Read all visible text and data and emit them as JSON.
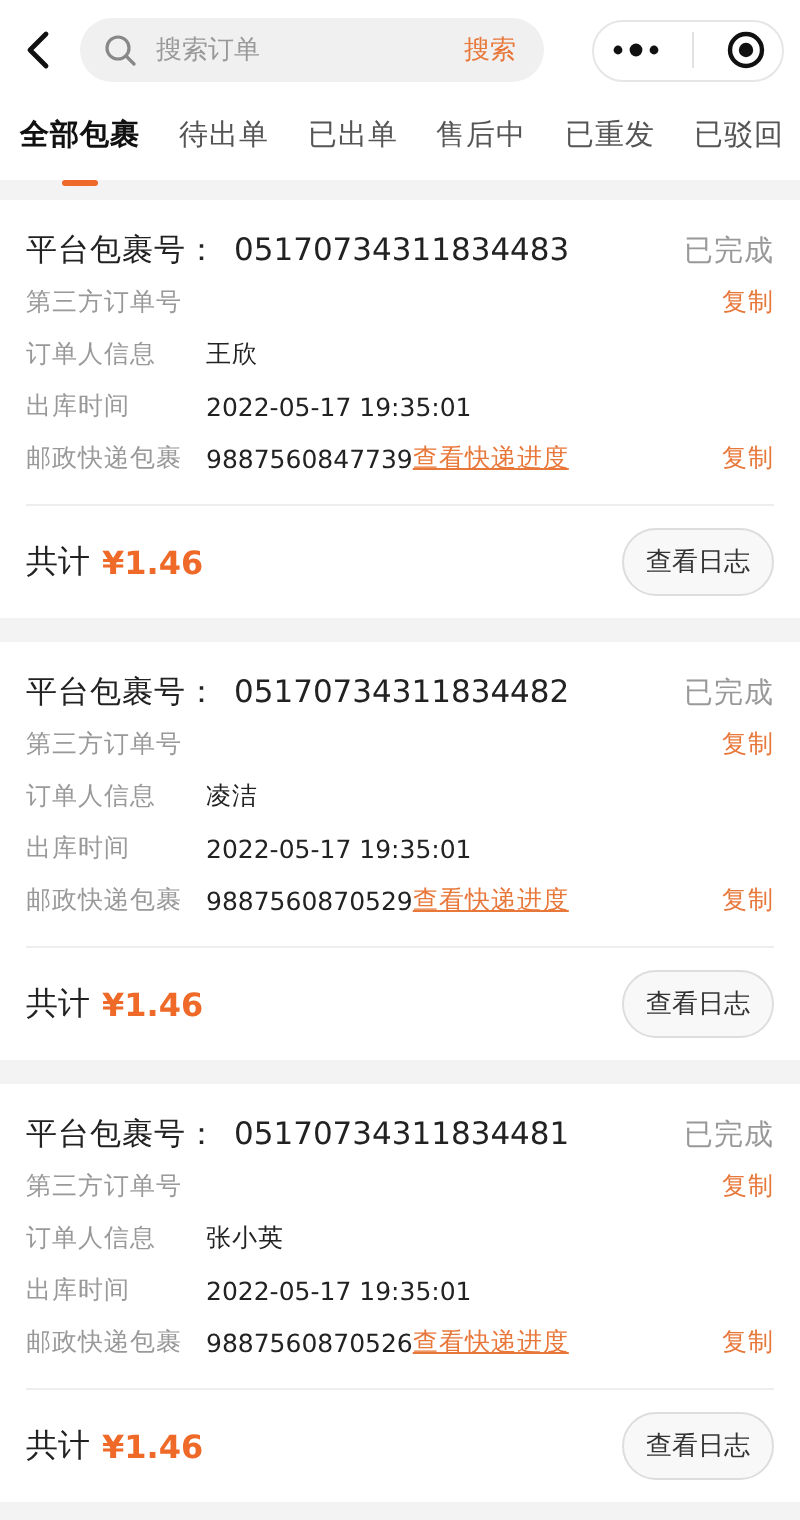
{
  "header": {
    "search": {
      "placeholder": "搜索订单",
      "button": "搜索"
    }
  },
  "tabs": [
    {
      "label": "全部包裹",
      "selected": true
    },
    {
      "label": "待出单",
      "selected": false
    },
    {
      "label": "已出单",
      "selected": false
    },
    {
      "label": "售后中",
      "selected": false
    },
    {
      "label": "已重发",
      "selected": false
    },
    {
      "label": "已驳回",
      "selected": false
    }
  ],
  "orders": [
    {
      "package_label": "平台包裹号：",
      "package_no": "05170734311834483",
      "status": "已完成",
      "fields": [
        {
          "label": "第三方订单号",
          "action": "复制"
        },
        {
          "label": "订单人信息",
          "value": "王欣"
        },
        {
          "label": "出库时间",
          "value": "2022-05-17 19:35:01"
        },
        {
          "label": "邮政快递包裹",
          "value": "9887560847739",
          "link": "查看快递进度",
          "action": "复制"
        }
      ],
      "total_label": "共计",
      "total": "¥1.46",
      "log_button": "查看日志"
    },
    {
      "package_label": "平台包裹号：",
      "package_no": "05170734311834482",
      "status": "已完成",
      "fields": [
        {
          "label": "第三方订单号",
          "action": "复制"
        },
        {
          "label": "订单人信息",
          "value": "凌洁"
        },
        {
          "label": "出库时间",
          "value": "2022-05-17 19:35:01"
        },
        {
          "label": "邮政快递包裹",
          "value": "9887560870529",
          "link": "查看快递进度",
          "action": "复制"
        }
      ],
      "total_label": "共计",
      "total": "¥1.46",
      "log_button": "查看日志"
    },
    {
      "package_label": "平台包裹号：",
      "package_no": "05170734311834481",
      "status": "已完成",
      "fields": [
        {
          "label": "第三方订单号",
          "action": "复制"
        },
        {
          "label": "订单人信息",
          "value": "张小英"
        },
        {
          "label": "出库时间",
          "value": "2022-05-17 19:35:01"
        },
        {
          "label": "邮政快递包裹",
          "value": "9887560870526",
          "link": "查看快递进度",
          "action": "复制"
        }
      ],
      "total_label": "共计",
      "total": "¥1.46",
      "log_button": "查看日志"
    }
  ]
}
